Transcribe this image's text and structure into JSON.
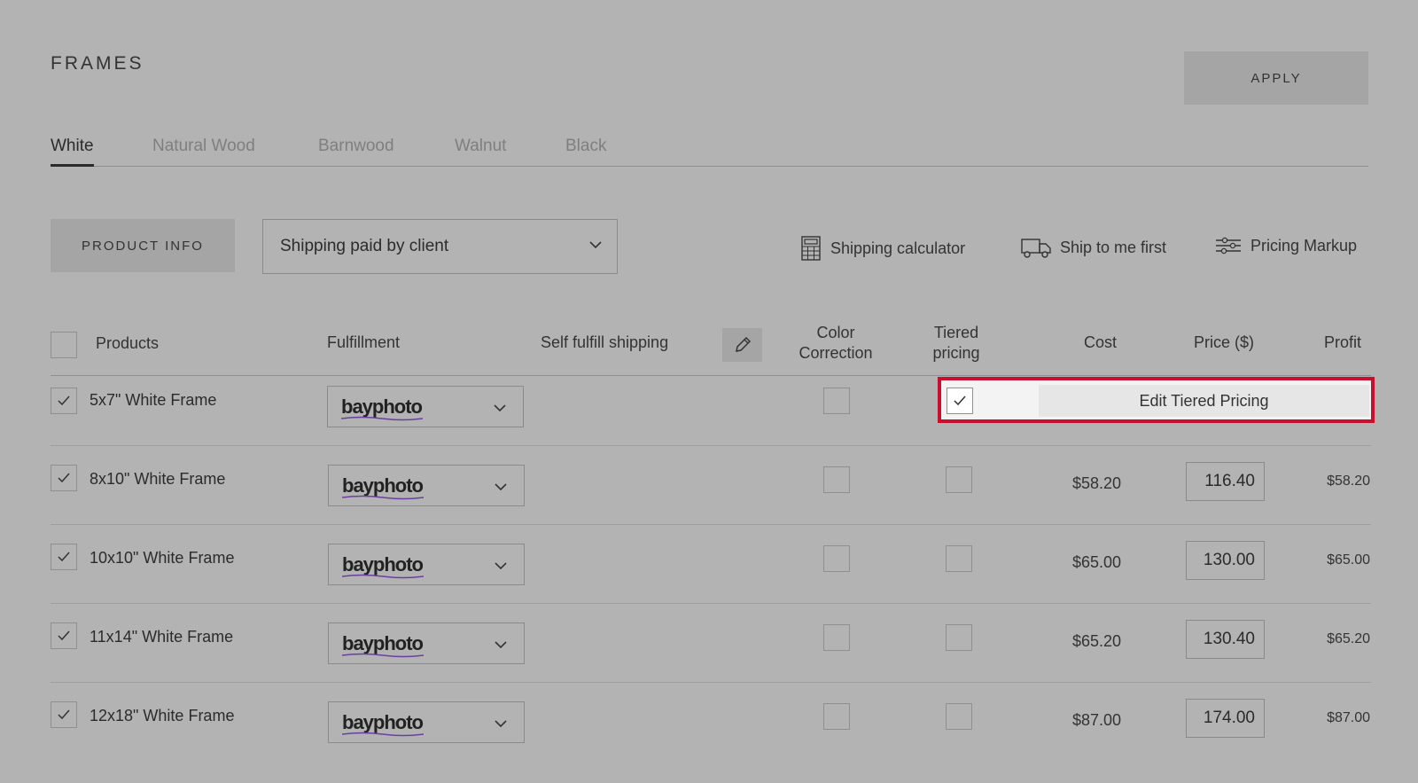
{
  "header": {
    "title": "FRAMES",
    "apply_label": "APPLY"
  },
  "tabs": [
    {
      "label": "White",
      "active": true
    },
    {
      "label": "Natural Wood",
      "active": false
    },
    {
      "label": "Barnwood",
      "active": false
    },
    {
      "label": "Walnut",
      "active": false
    },
    {
      "label": "Black",
      "active": false
    }
  ],
  "toolbar": {
    "product_info_label": "PRODUCT INFO",
    "shipping_value": "Shipping paid by client",
    "shipping_calculator_label": "Shipping calculator",
    "ship_to_me_label": "Ship to me first",
    "pricing_markup_label": "Pricing Markup"
  },
  "table": {
    "headers": {
      "products": "Products",
      "fulfillment": "Fulfillment",
      "self_fulfill": "Self fulfill shipping",
      "color_correction_1": "Color",
      "color_correction_2": "Correction",
      "tiered_1": "Tiered",
      "tiered_2": "pricing",
      "cost": "Cost",
      "price": "Price ($)",
      "profit": "Profit"
    },
    "edit_tiered_label": "Edit Tiered Pricing",
    "rows": [
      {
        "name": "5x7\" White Frame",
        "fulfillment": "bayphoto",
        "cost": "",
        "price": "",
        "profit": "",
        "tiered": true
      },
      {
        "name": "8x10\" White Frame",
        "fulfillment": "bayphoto",
        "cost": "$58.20",
        "price": "116.40",
        "profit": "$58.20",
        "tiered": false
      },
      {
        "name": "10x10\" White Frame",
        "fulfillment": "bayphoto",
        "cost": "$65.00",
        "price": "130.00",
        "profit": "$65.00",
        "tiered": false
      },
      {
        "name": "11x14\" White Frame",
        "fulfillment": "bayphoto",
        "cost": "$65.20",
        "price": "130.40",
        "profit": "$65.20",
        "tiered": false
      },
      {
        "name": "12x18\" White Frame",
        "fulfillment": "bayphoto",
        "cost": "$87.00",
        "price": "174.00",
        "profit": "$87.00",
        "tiered": false
      }
    ]
  },
  "colors": {
    "background": "#b3b3b3",
    "highlight": "#c8102e",
    "button": "#a5a5a5"
  }
}
